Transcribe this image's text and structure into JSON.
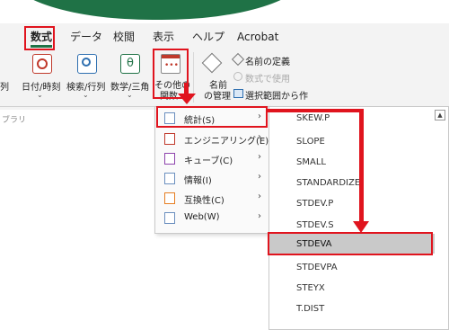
{
  "tabs": [
    {
      "label": "数式"
    },
    {
      "label": "データ"
    },
    {
      "label": "校閲"
    },
    {
      "label": "表示"
    },
    {
      "label": "ヘルプ"
    },
    {
      "label": "Acrobat"
    }
  ],
  "ribbon": {
    "cut_label": "列",
    "datetime_label": "日付/時刻",
    "lookup_label": "検索/行列",
    "math_label": "数学/三角",
    "more_label_1": "その他の",
    "more_label_2": "関数",
    "name_label_1": "名前",
    "name_label_2": "の管理",
    "define_name": "名前の定義",
    "use_in_formula": "数式で使用",
    "create_from_sel": "選択範囲から作",
    "group_label": "ブラリ"
  },
  "submenu": [
    {
      "label": "統計(S)"
    },
    {
      "label": "エンジニアリング(E)"
    },
    {
      "label": "キューブ(C)"
    },
    {
      "label": "情報(I)"
    },
    {
      "label": "互換性(C)"
    },
    {
      "label": "Web(W)"
    }
  ],
  "functions": [
    "SKEW.P",
    "SLOPE",
    "SMALL",
    "STANDARDIZE",
    "STDEV.P",
    "STDEV.S",
    "STDEVA",
    "STDEVPA",
    "STEYX",
    "T.DIST"
  ],
  "colors": {
    "accent": "#1f7246",
    "callout": "#e0141e",
    "highlight": "#c9c9c9"
  }
}
